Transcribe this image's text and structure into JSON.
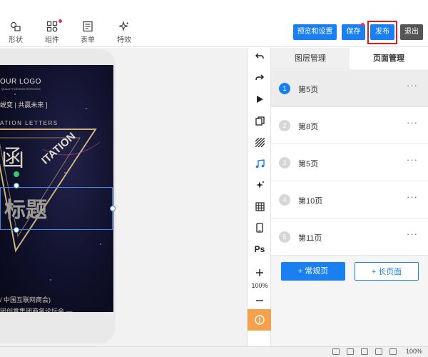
{
  "toolbar": {
    "tools": [
      {
        "label": "形状"
      },
      {
        "label": "组件"
      },
      {
        "label": "表单"
      },
      {
        "label": "特效"
      }
    ],
    "buttons": {
      "preview": "预览和设置",
      "save": "保存",
      "publish": "发布",
      "exit": "退出"
    }
  },
  "poster": {
    "logo": "OUR LOGO",
    "logo_sub": "QUALITY DESIGN SERVICES",
    "tagline": "蜕变 | 共赢未来 ]",
    "invitation_letters": "ATION LETTERS",
    "invitation": "ITATION",
    "big_chars": "函",
    "title": "标题",
    "footer_line1": "/ 中国互联网商会)",
    "footer_line2": "团创意集团商务论坛会 —"
  },
  "vtools": {
    "zoom": "100%",
    "ps_label": "Ps"
  },
  "panel": {
    "tabs": [
      "图层管理",
      "页面管理"
    ],
    "active_tab": 1,
    "pages": [
      {
        "number": "1",
        "name": "第5页"
      },
      {
        "number": "2",
        "name": "第8页"
      },
      {
        "number": "3",
        "name": "第5页"
      },
      {
        "number": "4",
        "name": "第10页"
      },
      {
        "number": "5",
        "name": "第11页"
      }
    ],
    "more": "···",
    "add_normal": "+ 常规页",
    "add_long": "+ 长页面"
  },
  "statusbar": {
    "zoom": "100%"
  },
  "colors": {
    "accent": "#1a7ff0",
    "highlight": "#e21b1b",
    "warning": "#f5a14c"
  }
}
